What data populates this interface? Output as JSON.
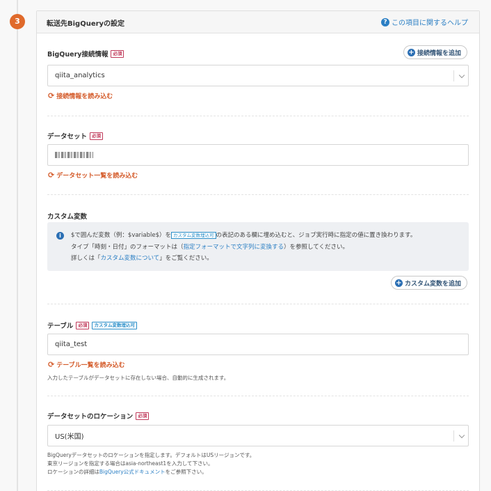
{
  "step": {
    "number": "3"
  },
  "panel": {
    "title": "転送先BigQueryの設定",
    "help_label": "この項目に関するヘルプ"
  },
  "required_label": "必須",
  "custom_var_tag": "カスタム変数埋込可",
  "connection": {
    "label": "BigQuery接続情報",
    "add_button": "接続情報を追加",
    "value": "qiita_analytics",
    "reload_label": "接続情報を読み込む"
  },
  "dataset": {
    "label": "データセット",
    "reload_label": "データセット一覧を読み込む"
  },
  "custom_vars": {
    "label": "カスタム変数",
    "info_line1_pre": "$で囲んだ変数（例：$variable$）を",
    "info_line1_post": "の表記のある欄に埋め込むと、ジョブ実行時に指定の値に置き換わります。",
    "info_line2_pre": "タイプ「時刻・日付」のフォーマットは（",
    "info_line2_link": "指定フォーマットで文字列に変換する",
    "info_line2_post": "）を参照してください。",
    "info_line3_pre": "詳しくは「",
    "info_line3_link": "カスタム変数について",
    "info_line3_post": "」をご覧ください。",
    "add_button": "カスタム変数を追加"
  },
  "table": {
    "label": "テーブル",
    "value": "qiita_test",
    "reload_label": "テーブル一覧を読み込む",
    "note": "入力したテーブルがデータセットに存在しない場合、自動的に生成されます。"
  },
  "location": {
    "label": "データセットのロケーション",
    "value": "US(米国)",
    "note1": "BigQueryデータセットのロケーションを指定します。デフォルトはUSリージョンです。",
    "note2": "東京リージョンを指定する場合はasia-northeast1を入力して下さい。",
    "note3_pre": "ロケーションの詳細は",
    "note3_link": "BigQuery公式ドキュメント",
    "note3_post": "をご参照下さい。"
  }
}
